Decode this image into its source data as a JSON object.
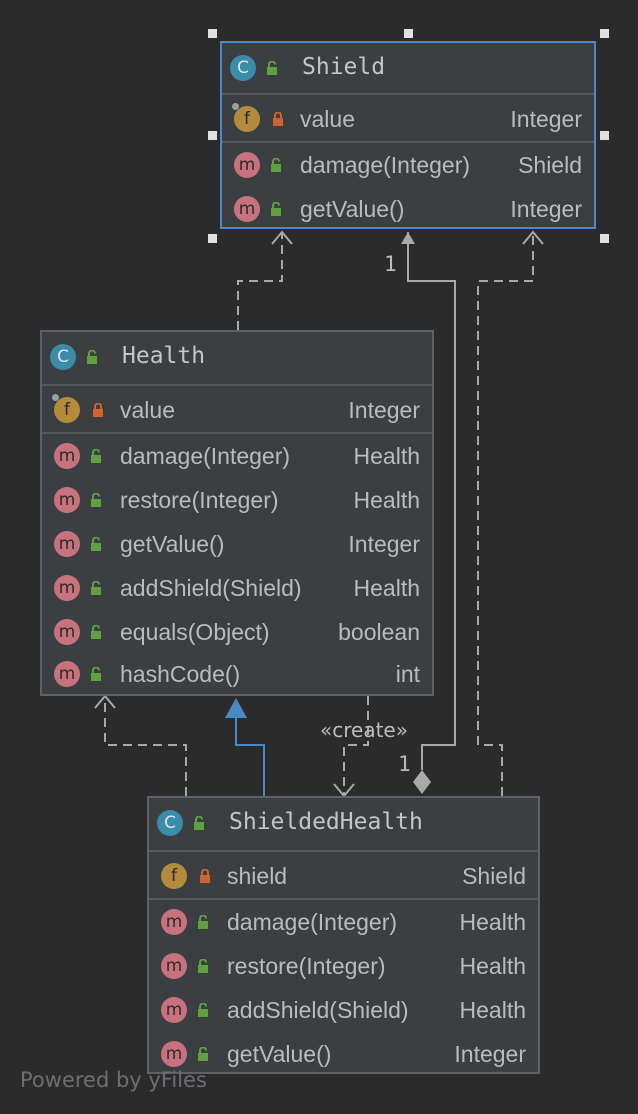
{
  "classes": {
    "shield": {
      "name": "Shield",
      "kind_icon": "C",
      "fields": [
        {
          "icon": "f",
          "name": "value",
          "type": "Integer"
        }
      ],
      "methods": [
        {
          "icon": "m",
          "name": "damage(Integer)",
          "type": "Shield"
        },
        {
          "icon": "m",
          "name": "getValue()",
          "type": "Integer"
        }
      ]
    },
    "health": {
      "name": "Health",
      "kind_icon": "C",
      "fields": [
        {
          "icon": "f",
          "name": "value",
          "type": "Integer"
        }
      ],
      "methods": [
        {
          "icon": "m",
          "name": "damage(Integer)",
          "type": "Health"
        },
        {
          "icon": "m",
          "name": "restore(Integer)",
          "type": "Health"
        },
        {
          "icon": "m",
          "name": "getValue()",
          "type": "Integer"
        },
        {
          "icon": "m",
          "name": "addShield(Shield)",
          "type": "Health"
        },
        {
          "icon": "m",
          "name": "equals(Object)",
          "type": "boolean"
        },
        {
          "icon": "m",
          "name": "hashCode()",
          "type": "int"
        }
      ]
    },
    "shielded_health": {
      "name": "ShieldedHealth",
      "kind_icon": "C",
      "fields": [
        {
          "icon": "f",
          "name": "shield",
          "type": "Shield"
        }
      ],
      "methods": [
        {
          "icon": "m",
          "name": "damage(Integer)",
          "type": "Health"
        },
        {
          "icon": "m",
          "name": "restore(Integer)",
          "type": "Health"
        },
        {
          "icon": "m",
          "name": "addShield(Shield)",
          "type": "Health"
        },
        {
          "icon": "m",
          "name": "getValue()",
          "type": "Integer"
        }
      ]
    }
  },
  "edges": {
    "create_label": "«create»",
    "multiplicity_shield_end": "1",
    "multiplicity_shieldedhealth_end": "1"
  },
  "footer": "Powered by yFiles",
  "colors": {
    "background": "#2b2b2b",
    "class_fill": "#3c3f41",
    "selected_border": "#4a88c7",
    "class_icon": "#3b8ca8",
    "field_icon": "#b38b3a",
    "method_icon": "#c7727d",
    "public_lock": "#5fa040",
    "private_lock": "#d0632b",
    "generalization": "#4a88c7",
    "dependency": "#a9a9a9"
  }
}
